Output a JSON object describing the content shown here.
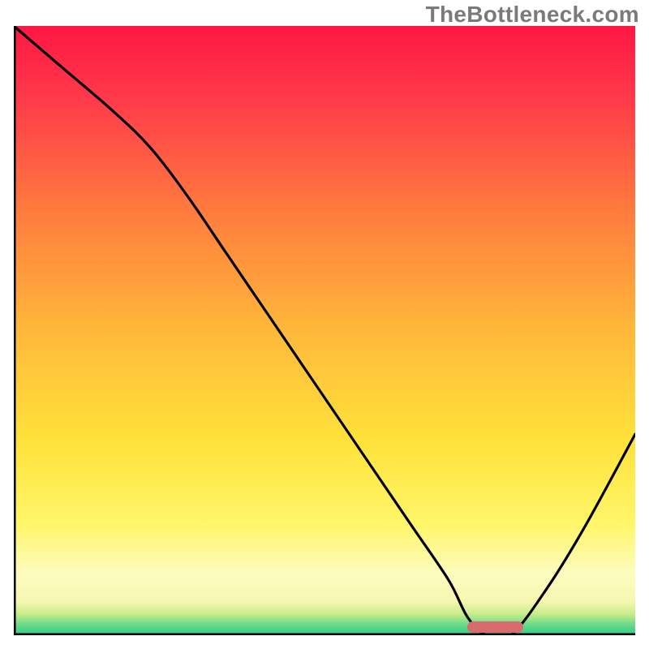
{
  "watermark": "TheBottleneck.com",
  "chart_data": {
    "type": "line",
    "title": "",
    "xlabel": "",
    "ylabel": "",
    "xlim": [
      0,
      100
    ],
    "ylim": [
      0,
      100
    ],
    "grid": false,
    "legend": false,
    "background_gradient_stops": [
      {
        "offset": 0.0,
        "color": "#ff1744"
      },
      {
        "offset": 0.12,
        "color": "#ff3a4a"
      },
      {
        "offset": 0.3,
        "color": "#ff7a3e"
      },
      {
        "offset": 0.5,
        "color": "#ffb83a"
      },
      {
        "offset": 0.68,
        "color": "#ffe23a"
      },
      {
        "offset": 0.82,
        "color": "#fff66a"
      },
      {
        "offset": 0.9,
        "color": "#fdfcc0"
      },
      {
        "offset": 0.945,
        "color": "#f4f7b0"
      },
      {
        "offset": 0.965,
        "color": "#c9ec8a"
      },
      {
        "offset": 0.985,
        "color": "#5fd88a"
      },
      {
        "offset": 1.0,
        "color": "#2ecf88"
      }
    ],
    "series": [
      {
        "name": "bottleneck-curve",
        "x": [
          0,
          8,
          16,
          22,
          28,
          34,
          40,
          46,
          52,
          58,
          64,
          70,
          73,
          76,
          80,
          86,
          92,
          100
        ],
        "y": [
          100,
          93,
          86,
          80,
          72,
          63,
          54,
          45,
          36,
          27,
          18,
          9,
          3,
          0,
          0,
          8,
          18,
          33
        ]
      }
    ],
    "optimal_marker": {
      "x_start": 73,
      "x_end": 82,
      "y": 1.3
    },
    "axes_color": "#000000",
    "curve_color": "#000000",
    "marker_color": "#d86b6e"
  }
}
